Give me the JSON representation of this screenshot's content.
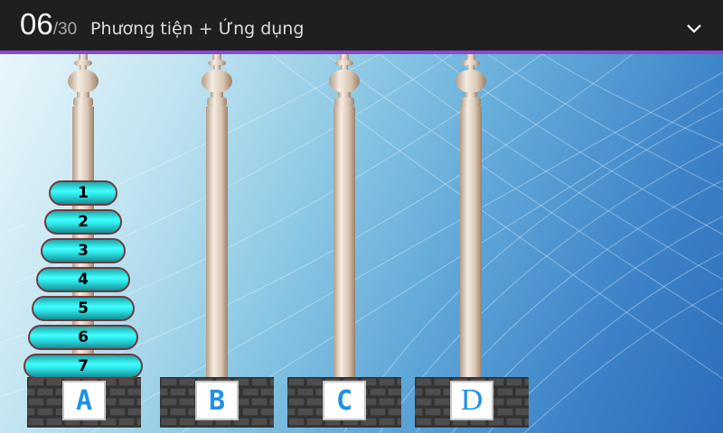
{
  "header": {
    "current": "06",
    "total": "/30",
    "title": "Phương tiện + Ứng dụng",
    "menu_icon": "chevron-down-icon"
  },
  "colors": {
    "topbar": "#1f1f1f",
    "accent": "#8b47d6",
    "disk": "#2ee3e7",
    "disk_border": "#6e3b3b",
    "label_text": "#1e90e8"
  },
  "poles": [
    {
      "label": "A",
      "disks": [
        "1",
        "2",
        "3",
        "4",
        "5",
        "6",
        "7"
      ]
    },
    {
      "label": "B",
      "disks": []
    },
    {
      "label": "C",
      "disks": []
    },
    {
      "label": "D",
      "disks": []
    }
  ]
}
